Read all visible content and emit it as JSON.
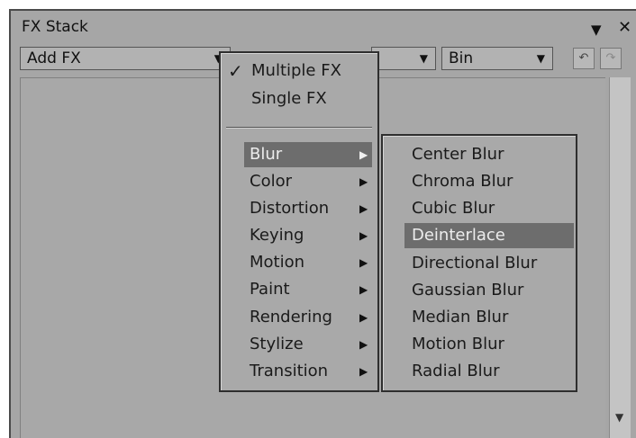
{
  "window": {
    "title": "FX Stack",
    "pin_icon": "pin-icon",
    "close_glyph": "✕"
  },
  "toolbar": {
    "add_fx": "Add FX",
    "combo2": "",
    "bin": "Bin",
    "undo_icon": "undo-icon",
    "redo_icon": "redo-icon"
  },
  "mode_menu": {
    "items": [
      {
        "label": "Multiple FX",
        "checked": true
      },
      {
        "label": "Single FX",
        "checked": false
      }
    ],
    "check_glyph": "✓"
  },
  "category_menu": {
    "items": [
      "Blur",
      "Color",
      "Distortion",
      "Keying",
      "Motion",
      "Paint",
      "Rendering",
      "Stylize",
      "Transition"
    ],
    "highlighted": "Blur"
  },
  "blur_submenu": {
    "items": [
      "Center Blur",
      "Chroma Blur",
      "Cubic Blur",
      "Deinterlace",
      "Directional Blur",
      "Gaussian Blur",
      "Median Blur",
      "Motion Blur",
      "Radial Blur"
    ],
    "highlighted": "Deinterlace"
  }
}
